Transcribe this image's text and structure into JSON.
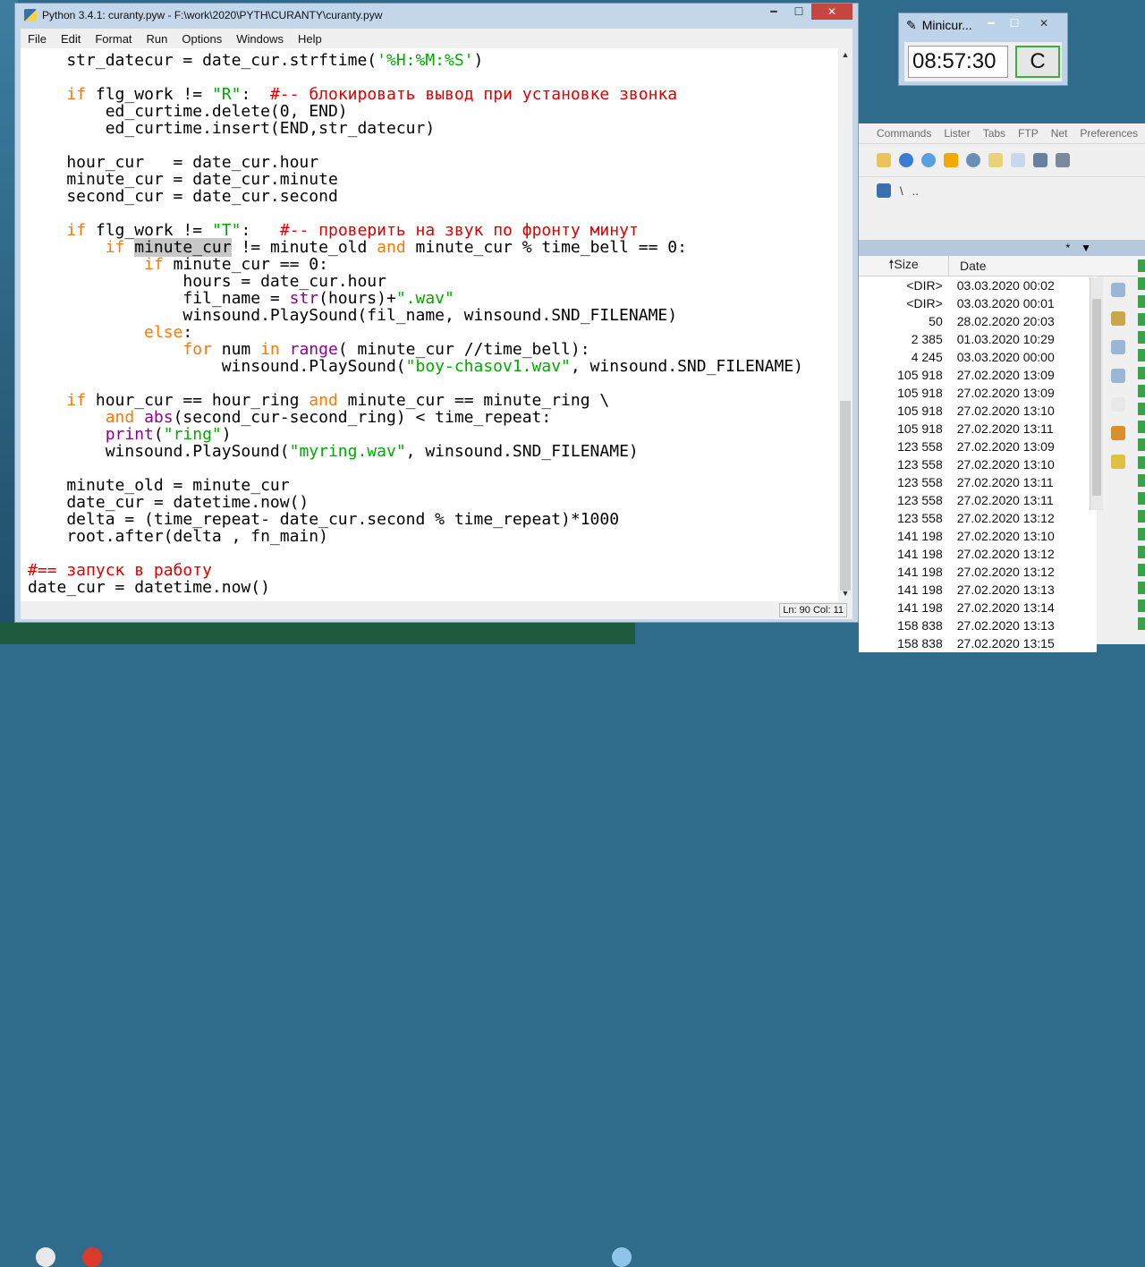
{
  "idle": {
    "title": "Python 3.4.1: curanty.pyw - F:\\work\\2020\\PYTH\\CURANTY\\curanty.pyw",
    "menu": [
      "File",
      "Edit",
      "Format",
      "Run",
      "Options",
      "Windows",
      "Help"
    ],
    "status": {
      "position": "Ln: 90  Col: 11"
    }
  },
  "minicur": {
    "title": "Minicur...",
    "time": "08:57:30",
    "button": "C"
  },
  "tc": {
    "menu": [
      "Commands",
      "Lister",
      "Tabs",
      "FTP",
      "Net",
      "Preferences"
    ],
    "path": [
      "\\",
      ".."
    ],
    "filter": "*",
    "columns": {
      "size": "Size",
      "date": "Date"
    },
    "rows": [
      {
        "size": "<DIR>",
        "date": "03.03.2020 00:02"
      },
      {
        "size": "<DIR>",
        "date": "03.03.2020 00:01"
      },
      {
        "size": "50",
        "date": "28.02.2020 20:03"
      },
      {
        "size": "2 385",
        "date": "01.03.2020 10:29"
      },
      {
        "size": "4 245",
        "date": "03.03.2020 00:00"
      },
      {
        "size": "105 918",
        "date": "27.02.2020 13:09"
      },
      {
        "size": "105 918",
        "date": "27.02.2020 13:09"
      },
      {
        "size": "105 918",
        "date": "27.02.2020 13:10"
      },
      {
        "size": "105 918",
        "date": "27.02.2020 13:11"
      },
      {
        "size": "123 558",
        "date": "27.02.2020 13:09"
      },
      {
        "size": "123 558",
        "date": "27.02.2020 13:10"
      },
      {
        "size": "123 558",
        "date": "27.02.2020 13:11"
      },
      {
        "size": "123 558",
        "date": "27.02.2020 13:11"
      },
      {
        "size": "123 558",
        "date": "27.02.2020 13:12"
      },
      {
        "size": "141 198",
        "date": "27.02.2020 13:10"
      },
      {
        "size": "141 198",
        "date": "27.02.2020 13:12"
      },
      {
        "size": "141 198",
        "date": "27.02.2020 13:12"
      },
      {
        "size": "141 198",
        "date": "27.02.2020 13:13"
      },
      {
        "size": "141 198",
        "date": "27.02.2020 13:14"
      },
      {
        "size": "158 838",
        "date": "27.02.2020 13:13"
      },
      {
        "size": "158 838",
        "date": "27.02.2020 13:15"
      }
    ]
  },
  "code_lines": [
    [
      {
        "t": "    str_datecur = date_cur.strftime(",
        "c": ""
      },
      {
        "t": "'%H:%M:%S'",
        "c": "st"
      },
      {
        "t": ")",
        "c": ""
      }
    ],
    [],
    [
      {
        "t": "    ",
        "c": ""
      },
      {
        "t": "if",
        "c": "kw"
      },
      {
        "t": " flg_work != ",
        "c": ""
      },
      {
        "t": "\"R\"",
        "c": "st"
      },
      {
        "t": ":  ",
        "c": ""
      },
      {
        "t": "#-- блокировать вывод при установке звонка",
        "c": "cm"
      }
    ],
    [
      {
        "t": "        ed_curtime.delete(0, END)",
        "c": ""
      }
    ],
    [
      {
        "t": "        ed_curtime.insert(END,str_datecur)",
        "c": ""
      }
    ],
    [],
    [
      {
        "t": "    hour_cur   = date_cur.hour",
        "c": ""
      }
    ],
    [
      {
        "t": "    minute_cur = date_cur.minute",
        "c": ""
      }
    ],
    [
      {
        "t": "    second_cur = date_cur.second",
        "c": ""
      }
    ],
    [],
    [
      {
        "t": "    ",
        "c": ""
      },
      {
        "t": "if",
        "c": "kw"
      },
      {
        "t": " flg_work != ",
        "c": ""
      },
      {
        "t": "\"T\"",
        "c": "st"
      },
      {
        "t": ":   ",
        "c": ""
      },
      {
        "t": "#-- проверить на звук по фронту минут",
        "c": "cm"
      }
    ],
    [
      {
        "t": "        ",
        "c": ""
      },
      {
        "t": "if",
        "c": "kw"
      },
      {
        "t": " ",
        "c": ""
      },
      {
        "t": "minute_cur",
        "c": "sel"
      },
      {
        "t": " != minute_old ",
        "c": ""
      },
      {
        "t": "and",
        "c": "kw"
      },
      {
        "t": " minute_cur % time_bell == 0:",
        "c": ""
      }
    ],
    [
      {
        "t": "            ",
        "c": ""
      },
      {
        "t": "if",
        "c": "kw"
      },
      {
        "t": " minute_cur == 0:",
        "c": ""
      }
    ],
    [
      {
        "t": "                hours = date_cur.hour",
        "c": ""
      }
    ],
    [
      {
        "t": "                fil_name = ",
        "c": ""
      },
      {
        "t": "str",
        "c": "bi"
      },
      {
        "t": "(hours)+",
        "c": ""
      },
      {
        "t": "\".wav\"",
        "c": "st"
      }
    ],
    [
      {
        "t": "                winsound.PlaySound(fil_name, winsound.SND_FILENAME)",
        "c": ""
      }
    ],
    [
      {
        "t": "            ",
        "c": ""
      },
      {
        "t": "else",
        "c": "kw"
      },
      {
        "t": ":",
        "c": ""
      }
    ],
    [
      {
        "t": "                ",
        "c": ""
      },
      {
        "t": "for",
        "c": "kw"
      },
      {
        "t": " num ",
        "c": ""
      },
      {
        "t": "in",
        "c": "kw"
      },
      {
        "t": " ",
        "c": ""
      },
      {
        "t": "range",
        "c": "bi"
      },
      {
        "t": "( minute_cur //time_bell):",
        "c": ""
      }
    ],
    [
      {
        "t": "                    winsound.PlaySound(",
        "c": ""
      },
      {
        "t": "\"boy-chasov1.wav\"",
        "c": "st"
      },
      {
        "t": ", winsound.SND_FILENAME)",
        "c": ""
      }
    ],
    [],
    [
      {
        "t": "    ",
        "c": ""
      },
      {
        "t": "if",
        "c": "kw"
      },
      {
        "t": " hour_cur == hour_ring ",
        "c": ""
      },
      {
        "t": "and",
        "c": "kw"
      },
      {
        "t": " minute_cur == minute_ring \\",
        "c": ""
      }
    ],
    [
      {
        "t": "        ",
        "c": ""
      },
      {
        "t": "and",
        "c": "kw"
      },
      {
        "t": " ",
        "c": ""
      },
      {
        "t": "abs",
        "c": "bi"
      },
      {
        "t": "(second_cur-second_ring) < time_repeat:",
        "c": ""
      }
    ],
    [
      {
        "t": "        ",
        "c": ""
      },
      {
        "t": "print",
        "c": "bi"
      },
      {
        "t": "(",
        "c": ""
      },
      {
        "t": "\"ring\"",
        "c": "st"
      },
      {
        "t": ")",
        "c": ""
      }
    ],
    [
      {
        "t": "        winsound.PlaySound(",
        "c": ""
      },
      {
        "t": "\"myring.wav\"",
        "c": "st"
      },
      {
        "t": ", winsound.SND_FILENAME)",
        "c": ""
      }
    ],
    [],
    [
      {
        "t": "    minute_old = minute_cur",
        "c": ""
      }
    ],
    [
      {
        "t": "    date_cur = datetime.now()",
        "c": ""
      }
    ],
    [
      {
        "t": "    delta = (time_repeat- date_cur.second % time_repeat)*1000",
        "c": ""
      }
    ],
    [
      {
        "t": "    root.after(delta , fn_main)",
        "c": ""
      }
    ],
    [],
    [
      {
        "t": "#== запуск в работу",
        "c": "cm"
      }
    ],
    [
      {
        "t": "date_cur = datetime.now()",
        "c": ""
      }
    ]
  ]
}
